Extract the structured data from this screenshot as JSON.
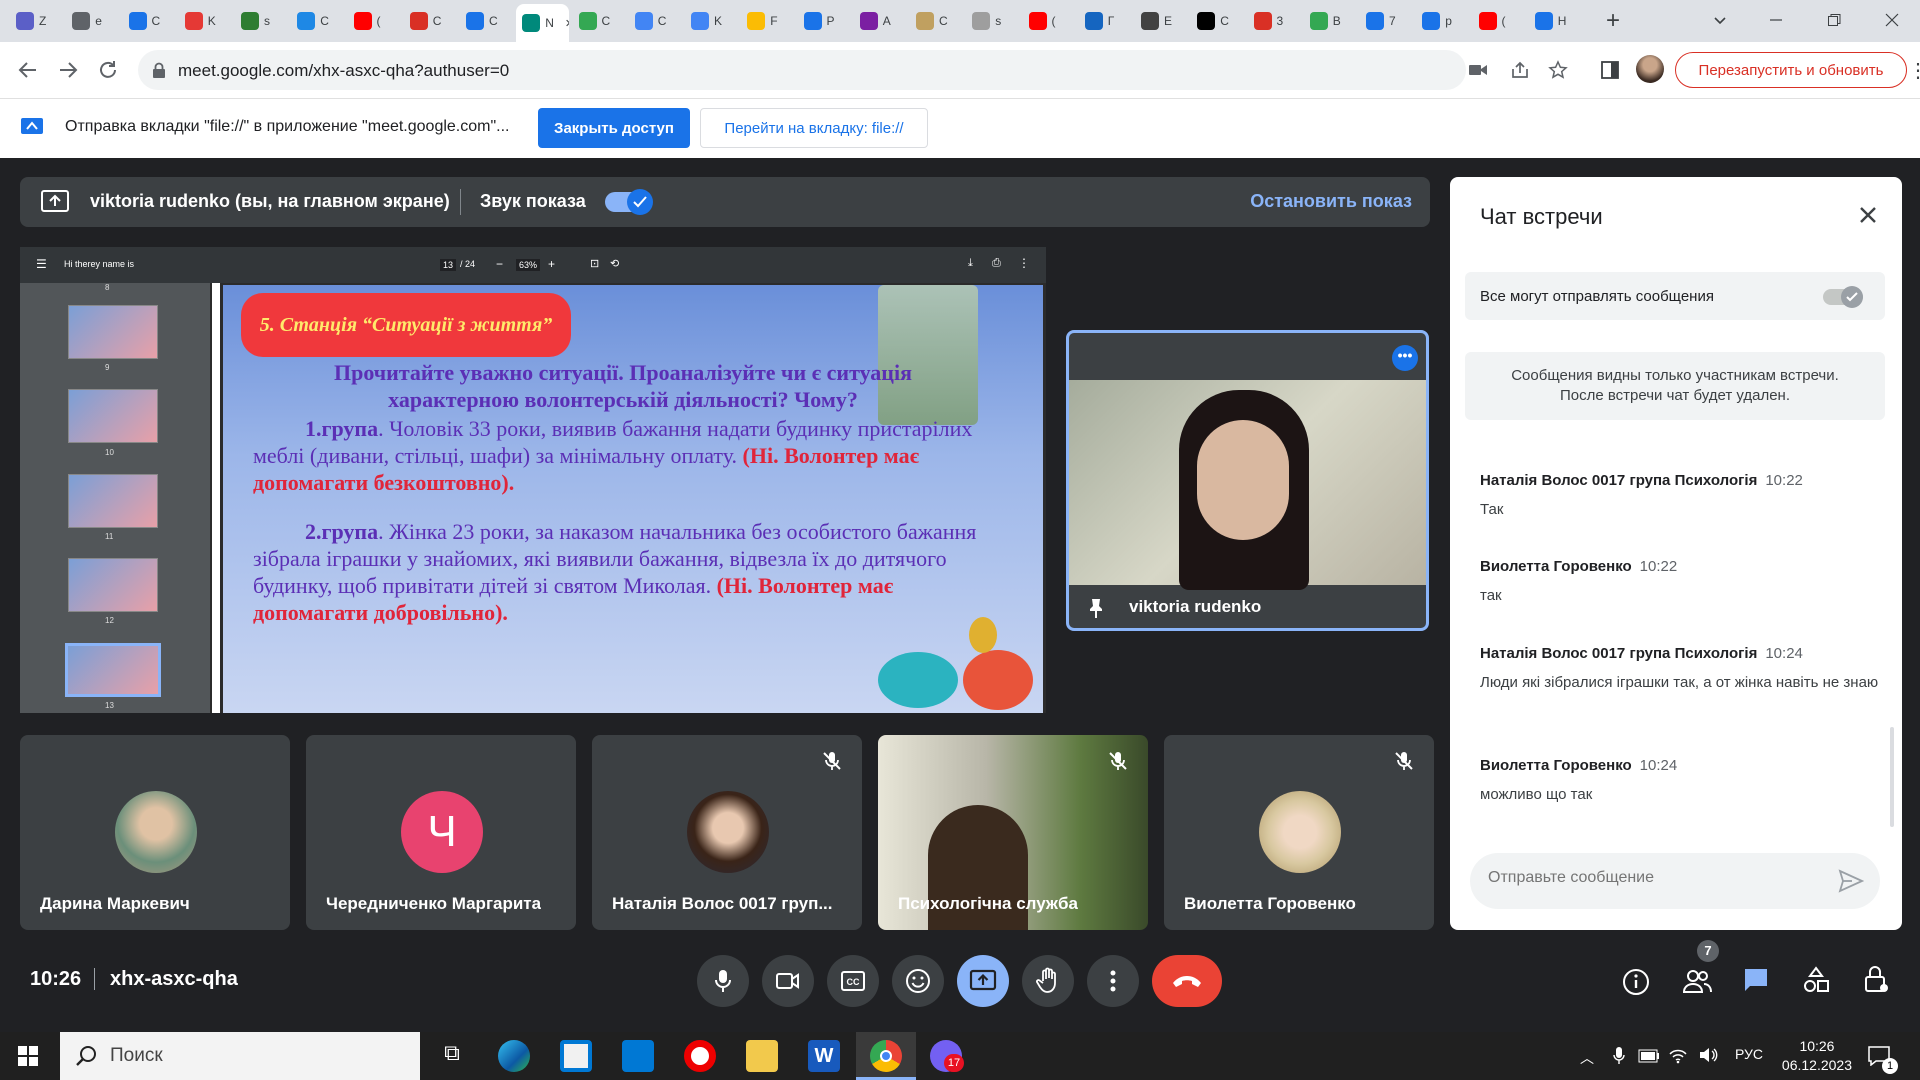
{
  "browser": {
    "tabs": [
      {
        "label": "Z",
        "color": "#5b5fc7"
      },
      {
        "label": "e",
        "color": "#5f6368"
      },
      {
        "label": "C",
        "color": "#1a73e8"
      },
      {
        "label": "K",
        "color": "#e53935"
      },
      {
        "label": "s",
        "color": "#2e7d32"
      },
      {
        "label": "C",
        "color": "#1e88e5"
      },
      {
        "label": "(",
        "color": "#ff0000"
      },
      {
        "label": "C",
        "color": "#d93025"
      },
      {
        "label": "C",
        "color": "#1a73e8"
      },
      {
        "label": "N",
        "color": "#00897b"
      },
      {
        "label": "C",
        "color": "#34a853"
      },
      {
        "label": "C",
        "color": "#4285f4"
      },
      {
        "label": "K",
        "color": "#4285f4"
      },
      {
        "label": "F",
        "color": "#fbbc04"
      },
      {
        "label": "P",
        "color": "#1a73e8"
      },
      {
        "label": "A",
        "color": "#7b1fa2"
      },
      {
        "label": "C",
        "color": "#c0a060"
      },
      {
        "label": "s",
        "color": "#9e9e9e"
      },
      {
        "label": "(",
        "color": "#ff0000"
      },
      {
        "label": "Г",
        "color": "#1565c0"
      },
      {
        "label": "E",
        "color": "#424242"
      },
      {
        "label": "C",
        "color": "#000000"
      },
      {
        "label": "3",
        "color": "#d93025"
      },
      {
        "label": "B",
        "color": "#34a853"
      },
      {
        "label": "7",
        "color": "#1a73e8"
      },
      {
        "label": "p",
        "color": "#1a73e8"
      },
      {
        "label": "(",
        "color": "#ff0000"
      },
      {
        "label": "H",
        "color": "#1a73e8"
      }
    ],
    "url": "meet.google.com/xhx-asxc-qha?authuser=0",
    "relaunch_label": "Перезапустить и обновить"
  },
  "banner": {
    "text": "Отправка вкладки \"file://\" в приложение \"meet.google.com\"...",
    "stop_label": "Закрыть доступ",
    "goto_label": "Перейти на вкладку: file://"
  },
  "presentation": {
    "presenter": "viktoria rudenko (вы, на главном экране)",
    "audio_label": "Звук показа",
    "stop_label": "Остановить показ"
  },
  "pdf": {
    "doc_title": "Hi therey name is",
    "page": "13",
    "pages": "/ 24",
    "zoom": "63%",
    "thumbs": [
      "8",
      "9",
      "10",
      "11",
      "12",
      "13"
    ]
  },
  "slide": {
    "title": "5. Станція “Ситуації з життя”",
    "heading1": "Прочитайте уважно ситуації. Проаналізуйте чи є ситуація",
    "heading2": "характерною волонтерській діяльності? Чому?",
    "g1_label": "1.група",
    "g1_text": ". Чоловік 33 роки, виявив бажання надати будинку пристарілих меблі (дивани, стільці, шафи) за мінімальну оплату. ",
    "g1_answer": "(Ні. Волонтер має допомагати безкоштовно).",
    "g2_label": "2.група",
    "g2_text": ". Жінка 23 роки, за наказом начальника без особистого бажання зібрала іграшки у знайомих, які виявили бажання, відвезла їх до дитячого будинку, щоб привітати дітей зі святом Миколая. ",
    "g2_answer": "(Ні. Волонтер має допомагати добровільно)."
  },
  "self_tile": {
    "name": "viktoria rudenko"
  },
  "participants": [
    {
      "name": "Дарина Маркевич",
      "type": "photo",
      "muted": false
    },
    {
      "name": "Чередниченко Маргарита",
      "type": "letter",
      "letter": "Ч",
      "color": "#e8436f",
      "muted": false
    },
    {
      "name": "Наталія Волос 0017 груп...",
      "type": "photo",
      "muted": true
    },
    {
      "name": "Психологічна служба",
      "type": "video",
      "muted": true
    },
    {
      "name": "Виолетта Горовенко",
      "type": "photo",
      "muted": true
    }
  ],
  "chat": {
    "title": "Чат встречи",
    "permission": "Все могут отправлять сообщения",
    "notice_line1": "Сообщения видны только участникам встречи.",
    "notice_line2": "После встречи чат будет удален.",
    "messages": [
      {
        "author": "Наталія Волос 0017 група Психологія",
        "time": "10:22",
        "text": "Так"
      },
      {
        "author": "Виолетта Горовенко",
        "time": "10:22",
        "text": "так"
      },
      {
        "author": "Наталія Волос 0017 група Психологія",
        "time": "10:24",
        "text": "Люди які зібралися іграшки так, а от жінка навіть не знаю"
      },
      {
        "author": "Виолетта Горовенко",
        "time": "10:24",
        "text": "можливо що так"
      }
    ],
    "input_placeholder": "Отправьте сообщение"
  },
  "controls": {
    "clock": "10:26",
    "meeting_code": "xhx-asxc-qha",
    "participant_count": "7"
  },
  "taskbar": {
    "search_label": "Поиск",
    "lang": "РУС",
    "time": "10:26",
    "date": "06.12.2023",
    "viber_badge": "17",
    "notif_count": "1"
  }
}
